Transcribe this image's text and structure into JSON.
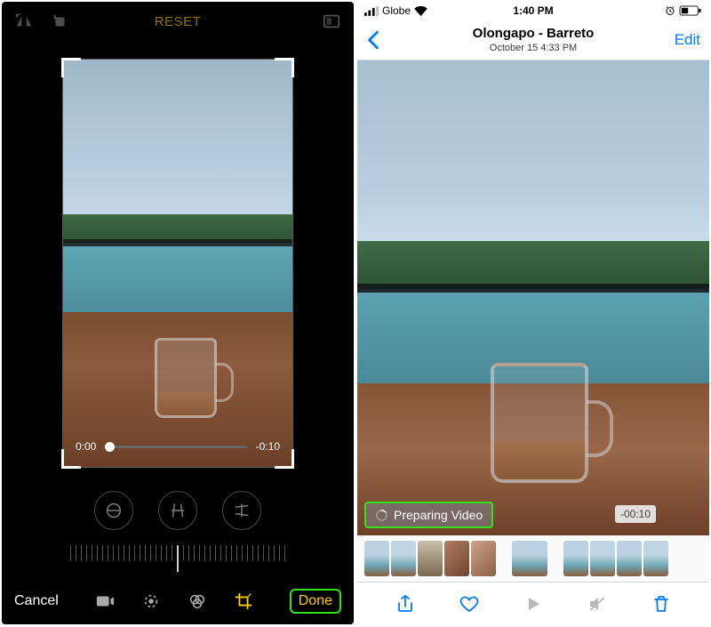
{
  "left": {
    "topbar": {
      "reset_label": "RESET"
    },
    "timeline": {
      "start": "0:00",
      "end": "-0:10"
    },
    "bottombar": {
      "cancel_label": "Cancel",
      "done_label": "Done"
    }
  },
  "right": {
    "statusbar": {
      "carrier": "Globe",
      "time": "1:40 PM",
      "signal_icon": "signal-icon",
      "wifi_icon": "wifi-icon",
      "alarm_icon": "alarm-icon",
      "battery_icon": "battery-icon"
    },
    "header": {
      "title": "Olongapo - Barreto",
      "subtitle": "October 15  4:33 PM",
      "edit_label": "Edit"
    },
    "badges": {
      "preparing": "Preparing Video",
      "remaining": "-00:10"
    }
  },
  "colors": {
    "ios_yellow": "#ffcc00",
    "ios_blue": "#007aff",
    "highlight_green": "#35e01c"
  }
}
